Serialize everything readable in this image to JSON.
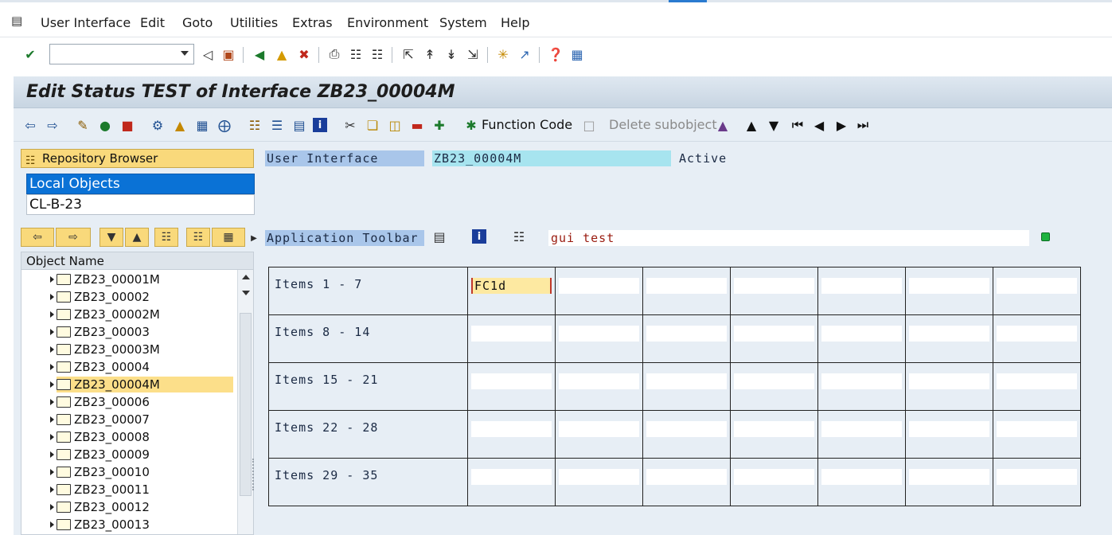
{
  "menu": {
    "items": [
      "User Interface",
      "Edit",
      "Goto",
      "Utilities",
      "Extras",
      "Environment",
      "System",
      "Help"
    ]
  },
  "std_toolbar": {
    "command_field": ""
  },
  "title": "Edit Status TEST of Interface ZB23_00004M",
  "app_toolbar": {
    "function_code": "Function Code",
    "delete_subobject": "Delete subobject"
  },
  "left_panel": {
    "repository_browser": "Repository Browser",
    "object_list_selected": "Local Objects",
    "object_list_value": "CL-B-23",
    "tree_header": "Object Name",
    "tree_items": [
      "ZB23_00001M",
      "ZB23_00002",
      "ZB23_00002M",
      "ZB23_00003",
      "ZB23_00003M",
      "ZB23_00004",
      "ZB23_00004M",
      "ZB23_00006",
      "ZB23_00007",
      "ZB23_00008",
      "ZB23_00009",
      "ZB23_00010",
      "ZB23_00011",
      "ZB23_00012",
      "ZB23_00013"
    ],
    "selected_item": "ZB23_00004M"
  },
  "header_fields": {
    "ui_label": "User Interface",
    "ui_value": "ZB23_00004M",
    "ui_status": "Active"
  },
  "application_toolbar": {
    "label": "Application Toolbar",
    "text": "gui test"
  },
  "items_table": {
    "rows": [
      {
        "label": "Items  1 -  7",
        "cells": [
          "FC1d",
          "",
          "",
          "",
          "",
          "",
          ""
        ]
      },
      {
        "label": "Items  8 - 14",
        "cells": [
          "",
          "",
          "",
          "",
          "",
          "",
          ""
        ]
      },
      {
        "label": "Items 15 - 21",
        "cells": [
          "",
          "",
          "",
          "",
          "",
          "",
          ""
        ]
      },
      {
        "label": "Items 22 - 28",
        "cells": [
          "",
          "",
          "",
          "",
          "",
          "",
          ""
        ]
      },
      {
        "label": "Items 29 - 35",
        "cells": [
          "",
          "",
          "",
          "",
          "",
          "",
          ""
        ]
      }
    ]
  },
  "colors": {
    "selection_blue": "#0a72d6",
    "tree_selected": "#fcdf8a",
    "status_green": "#1db33f",
    "gui_test_text": "#9a1c10"
  }
}
